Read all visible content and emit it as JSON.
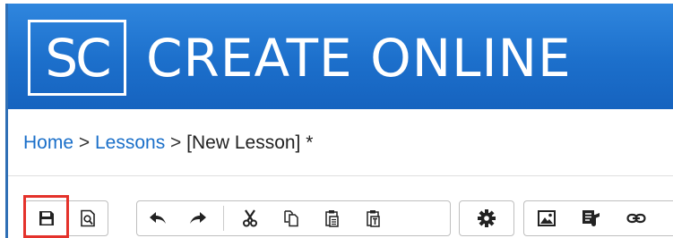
{
  "banner": {
    "logo": "SC",
    "title": "CREATE ONLINE"
  },
  "breadcrumb": {
    "home": "Home",
    "sep1": ">",
    "lessons": "Lessons",
    "sep2": ">",
    "current": "[New Lesson] *"
  },
  "toolbar": {
    "groups": [
      {
        "items": [
          "save-icon",
          "preview-icon"
        ]
      },
      {
        "items": [
          "undo-icon",
          "redo-icon",
          "cut-icon",
          "copy-icon",
          "paste-icon",
          "paste-text-icon"
        ]
      },
      {
        "items": [
          "settings-icon"
        ]
      },
      {
        "items": [
          "image-icon",
          "media-icon",
          "link-icon"
        ]
      }
    ],
    "highlighted": "save-icon"
  },
  "colors": {
    "banner": "#1c6fcb",
    "link": "#1a6fc9",
    "highlight": "#e4322b",
    "icon": "#222222"
  }
}
